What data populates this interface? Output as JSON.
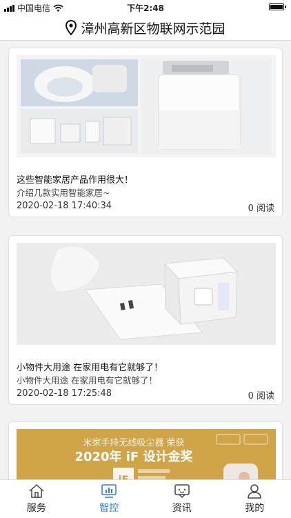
{
  "status_bar": {
    "carrier": "中国电信",
    "time": "下午2:48",
    "battery_level": 1.0
  },
  "header": {
    "title": "漳州高新区物联网示范园",
    "icon": "location-pin-icon"
  },
  "articles": [
    {
      "title": "这些智能家居产品作用很大！",
      "summary": "介绍几款实用智能家居~",
      "time": "2020-02-18 17:40:34",
      "reads": "0 阅读"
    },
    {
      "title": "小物件大用途 在家用电有它就够了！",
      "summary": "小物件大用途 在家用电有它就够了！",
      "time": "2020-02-18 17:25:48",
      "reads": "0 阅读"
    },
    {
      "image_text": {
        "line1": "米家手持无线吸尘器 荣获",
        "line2": "2020年 iF 设计金奖",
        "mark": "iF"
      }
    }
  ],
  "tabs": [
    {
      "label": "服务",
      "icon": "home-icon"
    },
    {
      "label": "智控",
      "icon": "monitor-chart-icon"
    },
    {
      "label": "资讯",
      "icon": "chat-icon"
    },
    {
      "label": "我的",
      "icon": "person-icon"
    }
  ],
  "active_tab": "智控",
  "colors": {
    "accent": "#2f7be4",
    "award_gold": "#c99a3a"
  }
}
